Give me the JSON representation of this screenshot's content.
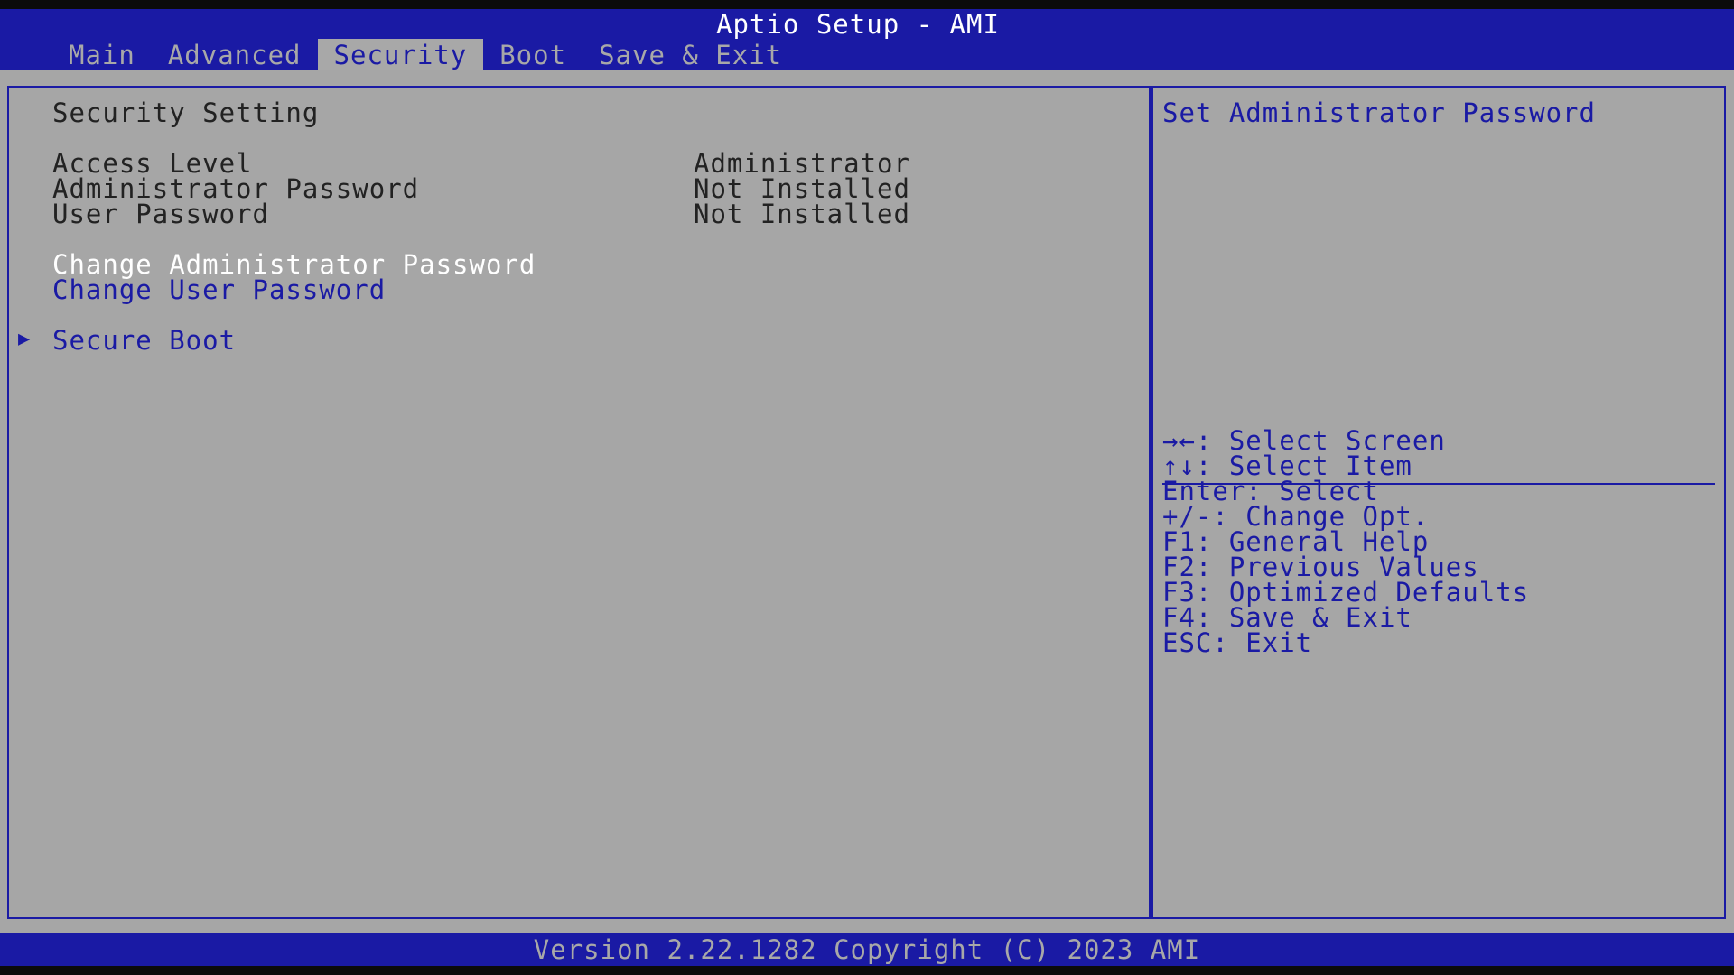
{
  "header": {
    "title": "Aptio Setup - AMI",
    "tabs": [
      {
        "label": "Main"
      },
      {
        "label": "Advanced"
      },
      {
        "label": "Security",
        "active": true
      },
      {
        "label": "Boot"
      },
      {
        "label": "Save & Exit"
      }
    ]
  },
  "main": {
    "section_title": "Security Setting",
    "info": [
      {
        "label": "Access Level",
        "value": "Administrator"
      },
      {
        "label": "Administrator Password",
        "value": "Not Installed"
      },
      {
        "label": "User Password",
        "value": "Not Installed"
      }
    ],
    "actions": [
      {
        "label": "Change Administrator Password",
        "selected": true
      },
      {
        "label": "Change User Password"
      }
    ],
    "submenu": {
      "label": "Secure Boot",
      "icon": "right-triangle-icon"
    }
  },
  "help": {
    "description": "Set Administrator Password",
    "keys": [
      "→←: Select Screen",
      "↑↓: Select Item",
      "Enter: Select",
      "+/-: Change Opt.",
      "F1: General Help",
      "F2: Previous Values",
      "F3: Optimized Defaults",
      "F4: Save & Exit",
      "ESC: Exit"
    ]
  },
  "footer": {
    "version": "Version 2.22.1282 Copyright (C) 2023 AMI"
  },
  "colors": {
    "bios_blue": "#1a1aa4",
    "bios_gray": "#a6a6a6",
    "text_dark": "#222222",
    "highlight_white": "#ffffff"
  }
}
